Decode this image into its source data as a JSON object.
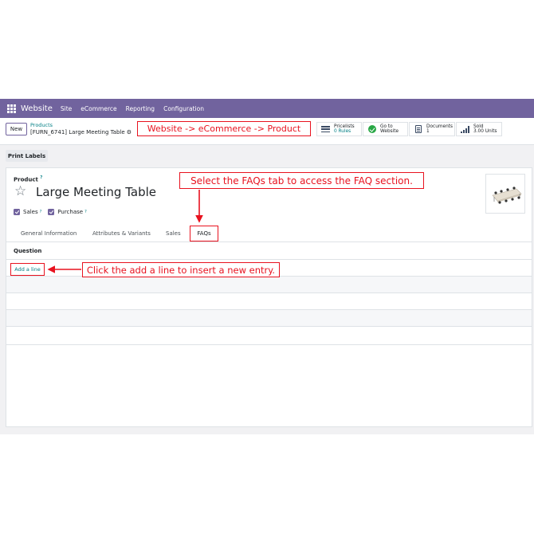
{
  "nav": {
    "brand": "Website",
    "items": [
      "Site",
      "eCommerce",
      "Reporting",
      "Configuration"
    ],
    "color": "#71639e"
  },
  "control": {
    "new_label": "New",
    "breadcrumb_parent": "Products",
    "breadcrumb_current": "[FURN_6741] Large Meeting Table",
    "stats": [
      {
        "label": "Pricelists",
        "value": "0 Rules",
        "icon": "list-icon"
      },
      {
        "label": "Go to",
        "value": "Website",
        "icon": "globe-check-icon"
      },
      {
        "label": "Documents",
        "value": "1",
        "icon": "document-icon"
      },
      {
        "label": "Sold",
        "value": "3.00 Units",
        "icon": "bar-chart-icon"
      }
    ]
  },
  "actions": {
    "print_labels": "Print Labels"
  },
  "form": {
    "product_label": "Product",
    "help_mark": "?",
    "product_name": "Large Meeting Table",
    "checkboxes": [
      {
        "label": "Sales",
        "checked": true
      },
      {
        "label": "Purchase",
        "checked": true
      }
    ],
    "tabs": [
      "General Information",
      "Attributes & Variants",
      "Sales",
      "FAQs"
    ],
    "active_tab": "FAQs",
    "column_header": "Question",
    "add_line": "Add a line"
  },
  "annotations": {
    "breadcrumb_note": "Website -> eCommerce -> Product",
    "tab_note": "Select the FAQs tab to access the FAQ section.",
    "add_note": "Click the add a line to insert a new entry.",
    "color": "#e8121f"
  }
}
